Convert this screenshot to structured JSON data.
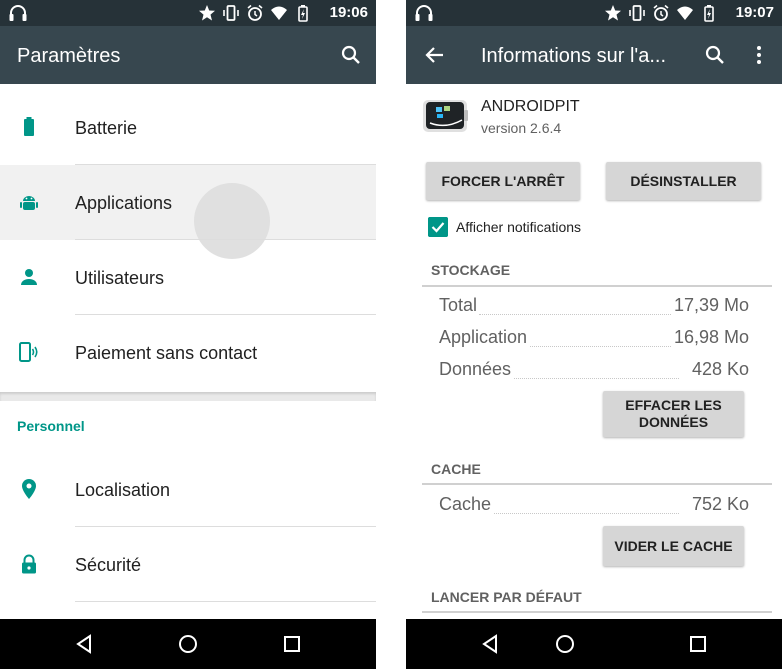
{
  "left": {
    "status": {
      "time": "19:06"
    },
    "toolbar": {
      "title": "Paramètres"
    },
    "items": [
      {
        "label": "Batterie",
        "icon": "battery-icon"
      },
      {
        "label": "Applications",
        "icon": "android-icon"
      },
      {
        "label": "Utilisateurs",
        "icon": "person-icon"
      },
      {
        "label": "Paiement sans contact",
        "icon": "nfc-phone-icon"
      }
    ],
    "section_header": "Personnel",
    "items2": [
      {
        "label": "Localisation",
        "icon": "location-icon"
      },
      {
        "label": "Sécurité",
        "icon": "lock-icon"
      }
    ]
  },
  "right": {
    "status": {
      "time": "19:07"
    },
    "toolbar": {
      "title": "Informations sur l'a..."
    },
    "app": {
      "name": "ANDROIDPIT",
      "version": "version 2.6.4"
    },
    "buttons": {
      "force_stop": "FORCER L'ARRÊT",
      "uninstall": "DÉSINSTALLER",
      "clear_data": "EFFACER LES DONNÉES",
      "clear_cache": "VIDER LE CACHE"
    },
    "notifications": {
      "label": "Afficher notifications",
      "checked": true
    },
    "storage": {
      "title": "STOCKAGE",
      "rows": [
        {
          "key": "Total",
          "value": "17,39 Mo"
        },
        {
          "key": "Application",
          "value": "16,98 Mo"
        },
        {
          "key": "Données",
          "value": "428 Ko"
        }
      ]
    },
    "cache": {
      "title": "CACHE",
      "rows": [
        {
          "key": "Cache",
          "value": "752 Ko"
        }
      ]
    },
    "launch_default": {
      "title": "LANCER PAR DÉFAUT"
    }
  },
  "colors": {
    "accent": "#009688",
    "toolbar": "#37474f",
    "statusbar": "#263238"
  }
}
